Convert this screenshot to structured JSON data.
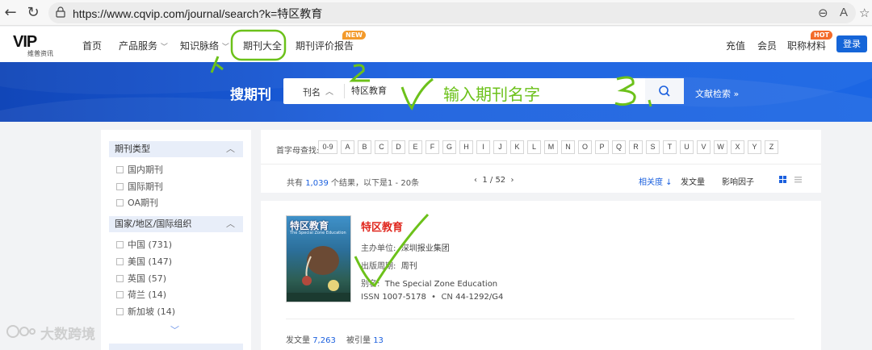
{
  "browser": {
    "url": "https://www.cqvip.com/journal/search?k=特区教育"
  },
  "header": {
    "logo_text": "VIP",
    "logo_sub": "维普资讯",
    "nav": [
      {
        "label": "首页"
      },
      {
        "label": "产品服务"
      },
      {
        "label": "知识脉络"
      },
      {
        "label": "期刊大全"
      },
      {
        "label": "期刊评价报告",
        "badge": "NEW"
      }
    ],
    "right_nav": [
      {
        "label": "充值"
      },
      {
        "label": "会员"
      },
      {
        "label": "职称材料",
        "badge": "HOT"
      }
    ],
    "login_label": "登录"
  },
  "search": {
    "title": "搜期刊",
    "field_type": "刊名",
    "query": "特区教育",
    "advanced_link": "文献检索 »"
  },
  "sidebar": {
    "facets": [
      {
        "title": "期刊类型",
        "items": [
          "国内期刊",
          "国际期刊",
          "OA期刊"
        ]
      },
      {
        "title": "国家/地区/国际组织",
        "items": [
          "中国 (731)",
          "美国 (147)",
          "英国 (57)",
          "荷兰 (14)",
          "新加坡 (14)"
        ]
      }
    ]
  },
  "alpha": {
    "label": "首字母查找:",
    "letters": [
      "0-9",
      "A",
      "B",
      "C",
      "D",
      "E",
      "F",
      "G",
      "H",
      "I",
      "J",
      "K",
      "L",
      "M",
      "N",
      "O",
      "P",
      "Q",
      "R",
      "S",
      "T",
      "U",
      "V",
      "W",
      "X",
      "Y",
      "Z"
    ]
  },
  "results_bar": {
    "summary_prefix": "共有",
    "total": "1,039",
    "summary_suffix": "个结果，以下是1 - 20条",
    "page": "1 / 52",
    "sort_relevance": "相关度 ↓",
    "sort_count": "发文量",
    "sort_impact": "影响因子"
  },
  "result": {
    "cover_title": "特区教育",
    "cover_sub": "The Special Zone Education",
    "title": "特区教育",
    "sponsor_label": "主办单位:",
    "sponsor": "深圳报业集团",
    "cycle_label": "出版周期:",
    "cycle": "周刊",
    "alias_label": "别名:",
    "alias": "The Special Zone Education",
    "issn_label": "ISSN",
    "issn": "1007-5178",
    "cn_label": "CN",
    "cn": "44-1292/G4",
    "articles_label": "发文量",
    "articles": "7,263",
    "cited_label": "被引量",
    "cited": "13"
  },
  "annotations": {
    "hint_text": "输入期刊名字",
    "color": "#6cc11a"
  },
  "watermark": {
    "text": "大数跨境"
  },
  "colors": {
    "brand_blue": "#1a5fde",
    "title_red": "#e0281f",
    "badge_orange": "#f39a2b"
  }
}
